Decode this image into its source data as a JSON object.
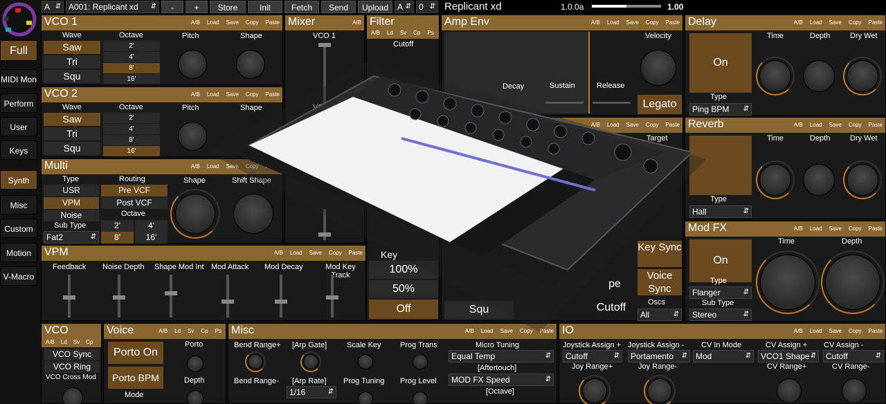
{
  "topbar": {
    "bank": "A",
    "program": "A001: Replicant xd",
    "minus": "-",
    "plus": "+",
    "store": "Store",
    "init": "Init",
    "fetch": "Fetch",
    "send": "Send",
    "upload": "Upload",
    "bank2": "A",
    "num": "0",
    "patch_name": "Replicant xd",
    "version": "1.0.0a",
    "volume": "1.00",
    "volume_frac": 0.5
  },
  "sidebar": {
    "full": "Full",
    "items": [
      "MIDI Mon",
      "Perform",
      "User",
      "Keys",
      "Synth",
      "Misc",
      "Custom",
      "Motion",
      "V-Macro"
    ],
    "active": "Synth"
  },
  "actions": {
    "ab": "A/B",
    "load": "Load",
    "save": "Save",
    "copy": "Copy",
    "paste": "Paste",
    "ld": "Ld",
    "sv": "Sv",
    "cp": "Cp",
    "ps": "Ps"
  },
  "vco1": {
    "title": "VCO 1",
    "wave_label": "Wave",
    "octave_label": "Octave",
    "pitch_label": "Pitch",
    "shape_label": "Shape",
    "waves": [
      "Saw",
      "Tri",
      "Squ"
    ],
    "octaves": [
      "2'",
      "4'",
      "8'",
      "16'"
    ],
    "wave_sel": 0,
    "oct_sel": 2
  },
  "vco2": {
    "title": "VCO 2",
    "wave_label": "Wave",
    "octave_label": "Octave",
    "pitch_label": "Pitch",
    "shape_label": "Shape",
    "waves": [
      "Saw",
      "Tri",
      "Squ"
    ],
    "octaves": [
      "2'",
      "4'",
      "8'",
      "16'"
    ],
    "wave_sel": 0,
    "oct_sel": 3
  },
  "multi": {
    "title": "Multi",
    "type_label": "Type",
    "routing_label": "Routing",
    "shape_label": "Shape",
    "shift_label": "Shift Shape",
    "types": [
      "USR",
      "VPM",
      "Noise"
    ],
    "routing": [
      "Pre VCF",
      "Post VCF"
    ],
    "octave_label": "Octave",
    "subtype_label": "Sub Type",
    "subtype": "Fat2",
    "octs": [
      "2'",
      "4'",
      "8'",
      "16'"
    ]
  },
  "vpm": {
    "title": "VPM",
    "labels": [
      "Feedback",
      "Noise Depth",
      "Shape Mod Int",
      "Mod Attack",
      "Mod Decay",
      "Mod Key Track"
    ]
  },
  "mixer": {
    "title": "Mixer",
    "vco1": "VCO 1",
    "vco2": "VCO 2"
  },
  "filter": {
    "title": "Filter",
    "cutoff": "Cutoff",
    "vals": [
      "100%",
      "50%",
      "Off"
    ],
    "key": "Key"
  },
  "ampenv": {
    "title": "Amp Env",
    "velocity": "Velocity",
    "decay": "Decay",
    "sustain": "Sustain",
    "release": "Release",
    "legato": "Legato"
  },
  "lfo": {
    "target": "Target",
    "key_sync": "Key Sync",
    "voice_sync": "Voice Sync",
    "oscs": "Oscs",
    "oscs_val": "All",
    "squ": "Squ",
    "cutoff": "Cutoff",
    "pe": "pe"
  },
  "delay": {
    "title": "Delay",
    "on": "On",
    "type_label": "Type",
    "type": "Ping BPM",
    "time": "Time",
    "depth": "Depth",
    "drywet": "Dry Wet"
  },
  "reverb": {
    "title": "Reverb",
    "type_label": "Type",
    "type": "Hall",
    "time": "Time",
    "depth": "Depth",
    "drywet": "Dry Wet"
  },
  "modfx": {
    "title": "Mod FX",
    "on": "On",
    "type_label": "Type",
    "type": "Flanger",
    "subtype_label": "Sub Type",
    "subtype": "Stereo",
    "time": "Time",
    "depth": "Depth"
  },
  "vco_bottom": {
    "title": "VCO",
    "sync": "VCO Sync",
    "ring": "VCO Ring",
    "cross": "VCO Cross Mod"
  },
  "voice": {
    "title": "Voice",
    "porto_on": "Porto On",
    "porto_bpm": "Porto BPM",
    "porto": "Porto",
    "depth": "Depth",
    "mode": "Mode"
  },
  "misc": {
    "title": "Misc",
    "bend_plus": "Bend Range+",
    "arp_gate": "[Arp Gate]",
    "scale_key": "Scale Key",
    "prog_trans": "Prog Trans",
    "micro": "Micro Tuning",
    "micro_val": "Equal Temp",
    "aftertouch": "[Aftertouch]",
    "after_val": "MOD FX Speed",
    "octave": "[Octave]",
    "bend_minus": "Bend Range-",
    "arp_rate": "[Arp Rate]",
    "arp_rate_val": "1/16",
    "prog_tuning": "Prog Tuning",
    "prog_level": "Prog Level"
  },
  "io": {
    "title": "IO",
    "js_plus": "Joystick Assign +",
    "js_minus": "Joystick Assign -",
    "cv_mode": "CV In Mode",
    "cv_plus": "CV Assign +",
    "cv_minus": "CV Assign -",
    "js_plus_val": "Cutoff",
    "js_minus_val": "Portamento",
    "cv_mode_val": "Mod",
    "cv_plus_val": "VCO1 Shape",
    "cv_minus_val": "Cutoff",
    "joy_plus": "Joy Range+",
    "joy_minus": "Joy Range-",
    "cvr_plus": "CV Range+",
    "cvr_minus": "CV Range-"
  }
}
